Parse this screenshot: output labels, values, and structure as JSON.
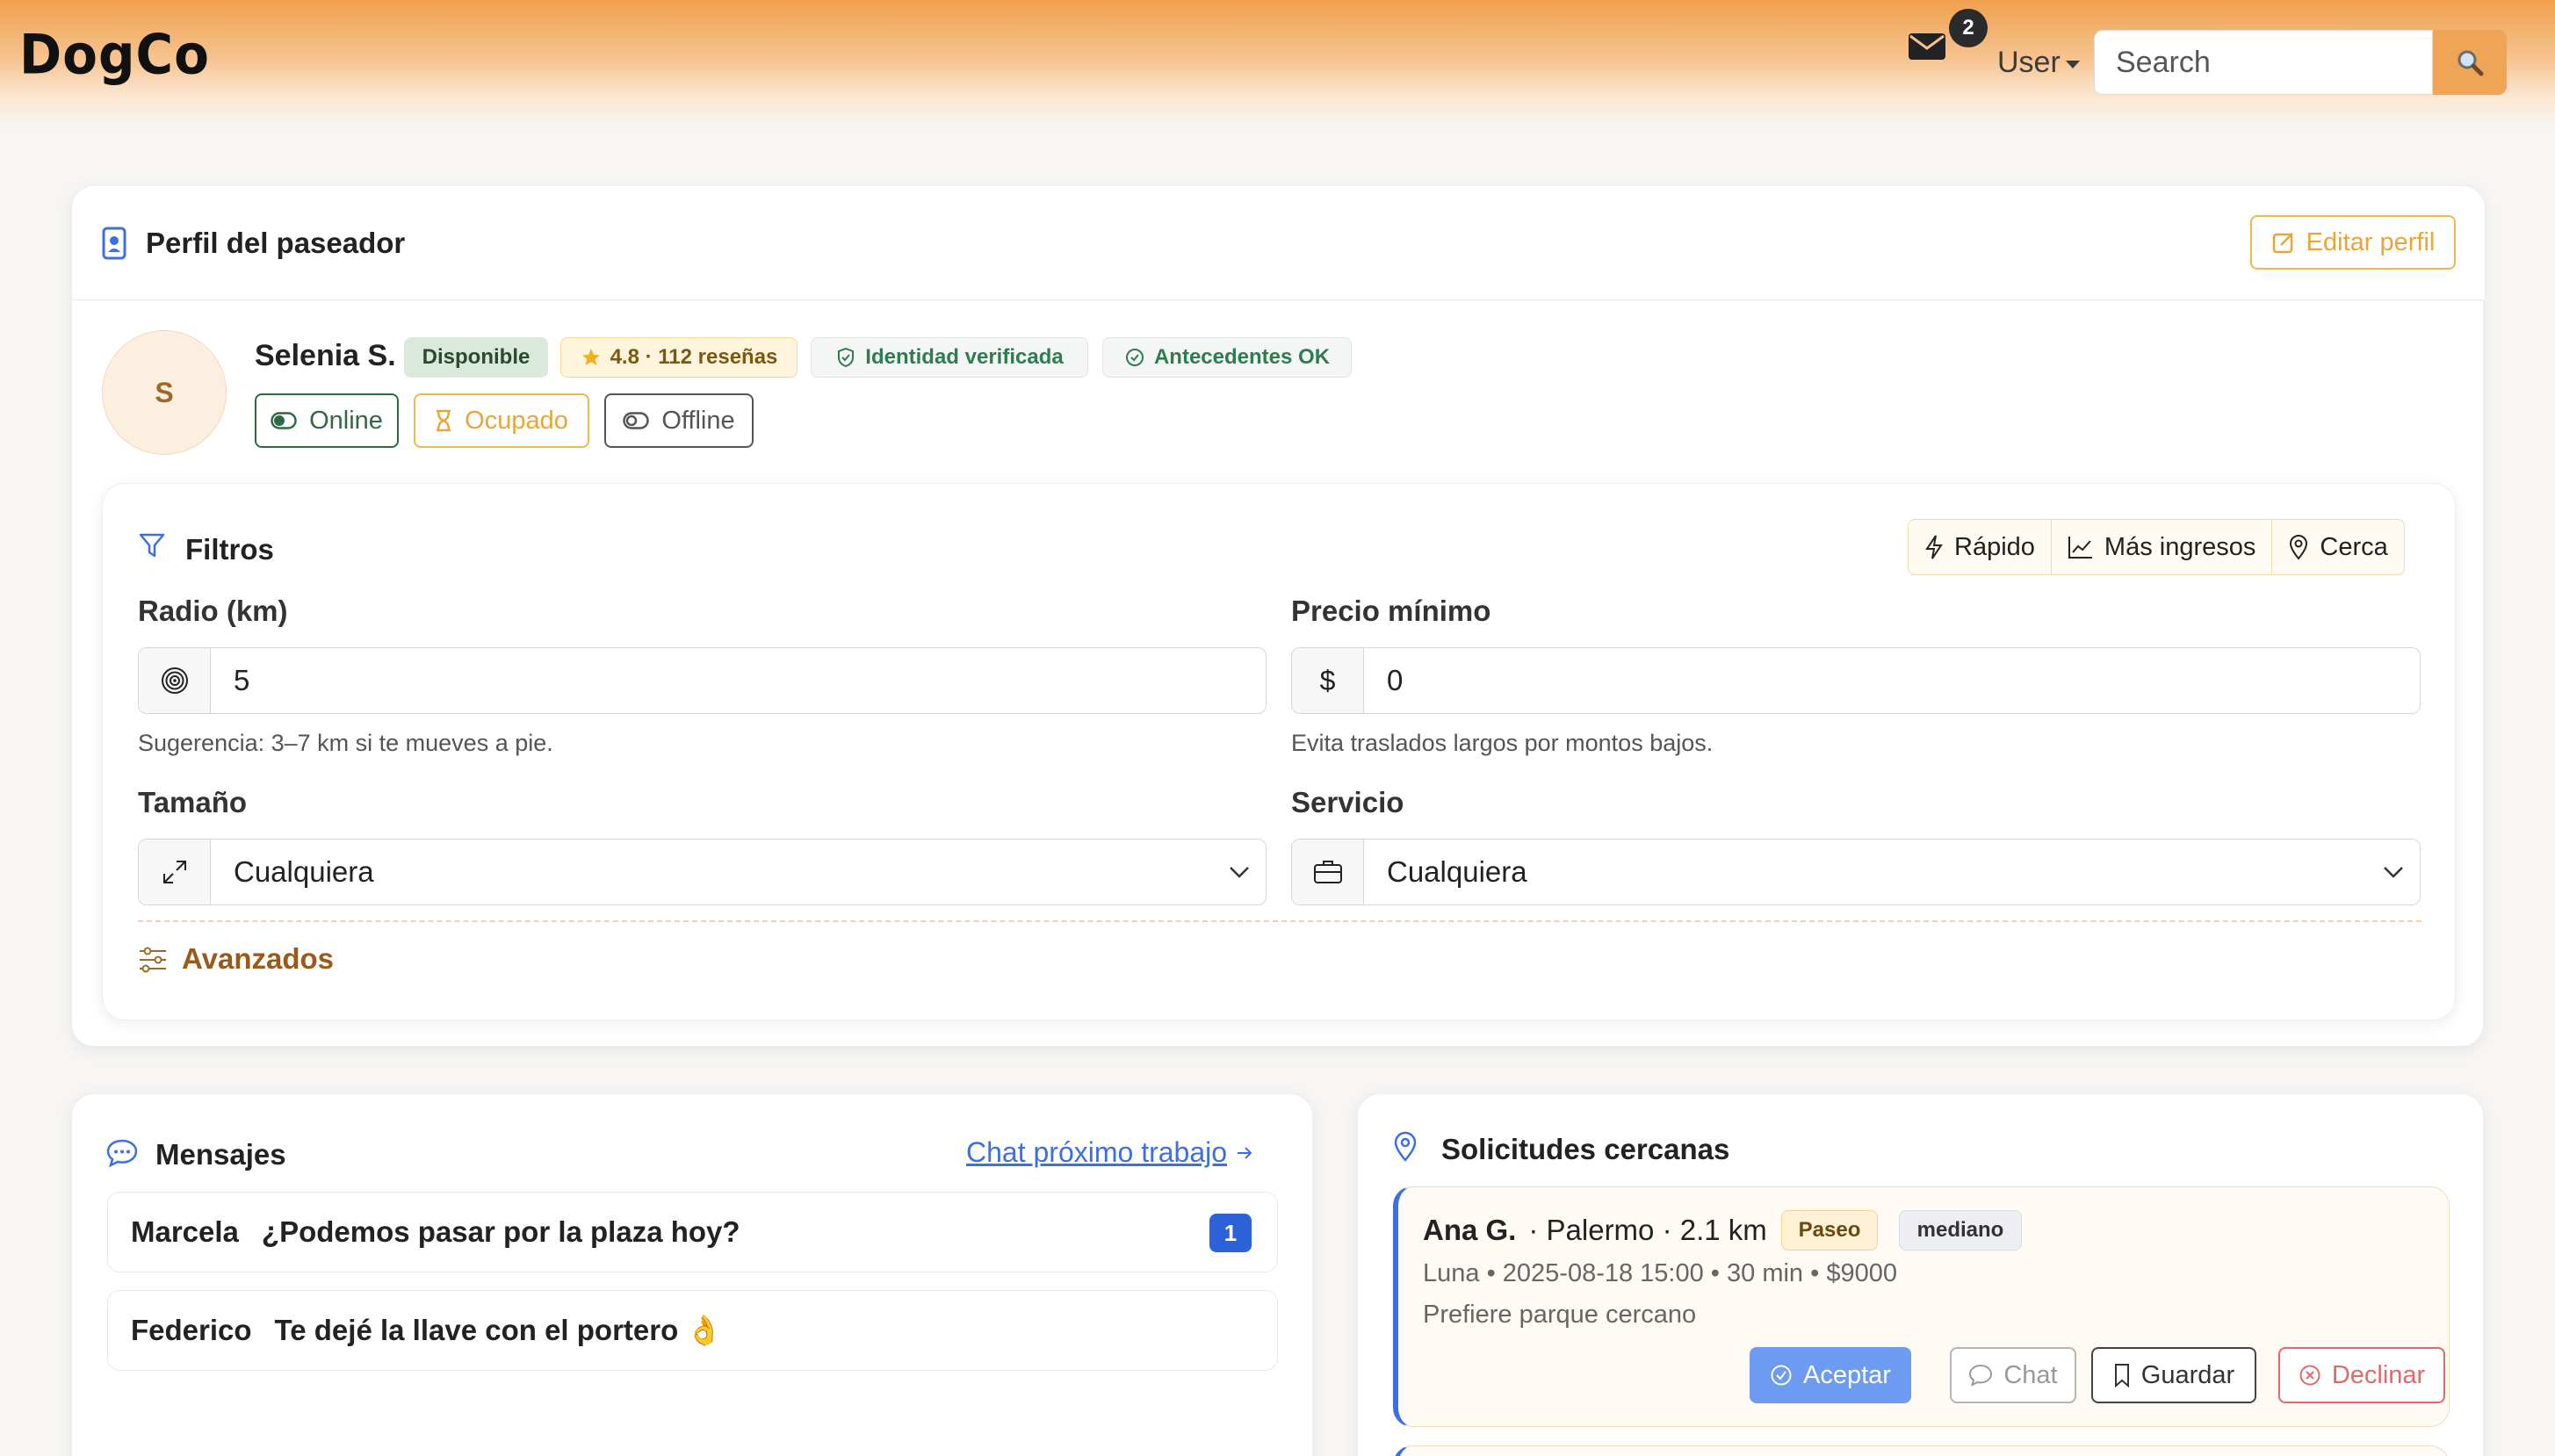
{
  "navbar": {
    "brand": "DogCo",
    "mail_badge": "2",
    "user_label": "User",
    "search_placeholder": "Search"
  },
  "profile": {
    "title": "Perfil del paseador",
    "edit_label": "Editar perfil",
    "avatar_initial": "S",
    "name": "Selenia S.",
    "status_badge": "Disponible",
    "rating_badge": "4.8 · 112 reseñas",
    "identity_badge": "Identidad verificada",
    "background_badge": "Antecedentes OK",
    "status_buttons": {
      "online": "Online",
      "busy": "Ocupado",
      "offline": "Offline"
    }
  },
  "filters": {
    "title": "Filtros",
    "quick": {
      "fast": "Rápido",
      "income": "Más ingresos",
      "near": "Cerca"
    },
    "radius_label": "Radio (km)",
    "radius_value": "5",
    "radius_help": "Sugerencia: 3–7 km si te mueves a pie.",
    "price_label": "Precio mínimo",
    "price_symbol": "$",
    "price_value": "0",
    "price_help": "Evita traslados largos por montos bajos.",
    "size_label": "Tamaño",
    "size_value": "Cualquiera",
    "service_label": "Servicio",
    "service_value": "Cualquiera",
    "advanced_label": "Avanzados"
  },
  "messages": {
    "title": "Mensajes",
    "chat_link": "Chat próximo trabajo",
    "items": [
      {
        "sender": "Marcela",
        "text": "¿Podemos pasar por la plaza hoy?",
        "unread": "1"
      },
      {
        "sender": "Federico",
        "text": "Te dejé la llave con el portero 👌"
      }
    ]
  },
  "requests": {
    "title": "Solicitudes cercanas",
    "items": [
      {
        "client": "Ana G.",
        "location": "· Palermo · 2.1 km",
        "service_tag": "Paseo",
        "size_tag": "mediano",
        "details": "Luna • 2025-08-18 15:00 • 30 min • $9000",
        "note": "Prefiere parque cercano",
        "accept_label": "Aceptar",
        "chat_label": "Chat",
        "save_label": "Guardar",
        "decline_label": "Declinar"
      }
    ]
  },
  "colors": {
    "accent_orange": "#f0a14f",
    "primary_blue": "#3c6fe0",
    "success_green": "#2e7d4f",
    "danger_red": "#e06a6a"
  }
}
